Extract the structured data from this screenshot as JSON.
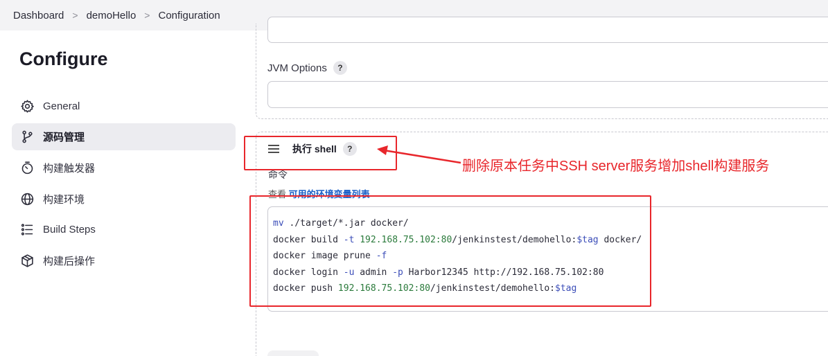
{
  "breadcrumb": [
    "Dashboard",
    "demoHello",
    "Configuration"
  ],
  "sidebar": {
    "title": "Configure",
    "items": [
      {
        "label": "General",
        "icon": "gear-icon",
        "active": false
      },
      {
        "label": "源码管理",
        "icon": "branch-icon",
        "active": true
      },
      {
        "label": "构建触发器",
        "icon": "timer-icon",
        "active": false
      },
      {
        "label": "构建环境",
        "icon": "globe-icon",
        "active": false
      },
      {
        "label": "Build Steps",
        "icon": "list-icon",
        "active": false
      },
      {
        "label": "构建后操作",
        "icon": "package-icon",
        "active": false
      }
    ]
  },
  "main": {
    "jvm_label": "JVM Options",
    "jvm_value": "",
    "help_glyph": "?",
    "shell_title": "执行 shell",
    "command_label": "命令",
    "env_prefix": "查看 ",
    "env_link": "可用的环境变量列表",
    "code_lines": [
      "mv ./target/*.jar docker/",
      "docker build -t 192.168.75.102:80/jenkinstest/demohello:$tag docker/",
      "docker image prune -f",
      "docker login -u admin -p Harbor12345 http://192.168.75.102:80",
      "docker push 192.168.75.102:80/jenkinstest/demohello:$tag"
    ]
  },
  "annotation": {
    "text": "删除原本任务中SSH server服务增加shell构建服务",
    "color": "#e8262b"
  }
}
